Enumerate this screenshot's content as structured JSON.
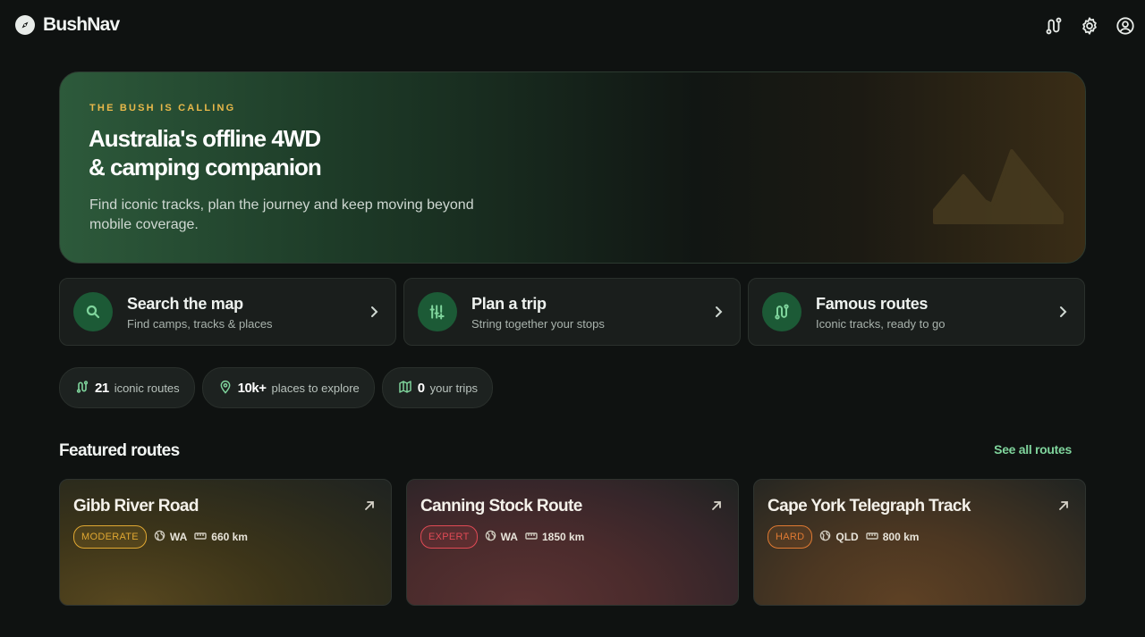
{
  "app": {
    "name": "BushNav"
  },
  "topbar": {
    "icons": [
      "route-icon",
      "settings-gear-icon",
      "account-icon"
    ]
  },
  "hero": {
    "eyebrow": "THE BUSH IS CALLING",
    "title_line1": "Australia's offline 4WD",
    "title_line2": "& camping companion",
    "subtitle": "Find iconic tracks, plan the journey and keep moving beyond mobile coverage."
  },
  "actions": [
    {
      "title": "Search the map",
      "subtitle": "Find camps, tracks & places",
      "icon": "search-icon"
    },
    {
      "title": "Plan a trip",
      "subtitle": "String together your stops",
      "icon": "trip-plan-icon"
    },
    {
      "title": "Famous routes",
      "subtitle": "Iconic tracks, ready to go",
      "icon": "route-icon"
    }
  ],
  "stats": [
    {
      "value": "21",
      "label": "iconic routes",
      "icon": "route-icon"
    },
    {
      "value": "10k+",
      "label": "places to explore",
      "icon": "map-pin-icon"
    },
    {
      "value": "0",
      "label": "your trips",
      "icon": "map-icon"
    }
  ],
  "featured": {
    "title": "Featured routes",
    "see_all": "See all routes",
    "routes": [
      {
        "name": "Gibb River Road",
        "difficulty": "MODERATE",
        "state": "WA",
        "distance": "660 km",
        "color": "#e0a832"
      },
      {
        "name": "Canning Stock Route",
        "difficulty": "EXPERT",
        "state": "WA",
        "distance": "1850 km",
        "color": "#e04a55"
      },
      {
        "name": "Cape York Telegraph Track",
        "difficulty": "HARD",
        "state": "QLD",
        "distance": "800 km",
        "color": "#e07a32"
      }
    ]
  },
  "colors": {
    "accent": "#7fd49c",
    "eyebrow": "#e8b84a",
    "background": "#0f1211"
  }
}
